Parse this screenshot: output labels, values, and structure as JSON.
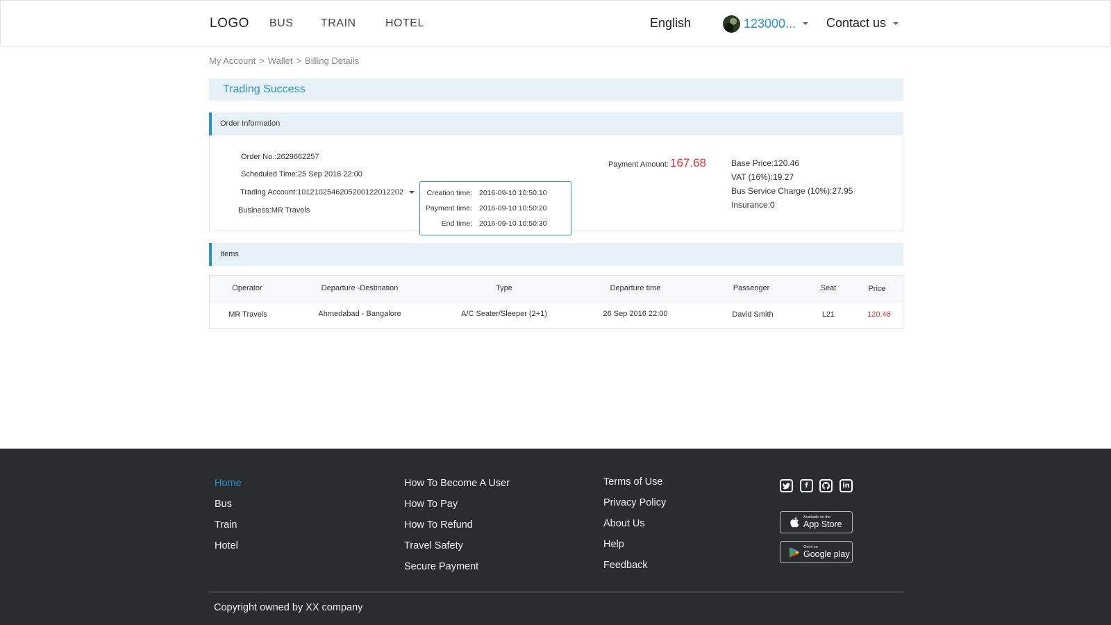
{
  "header": {
    "logo": "LOGO",
    "nav": [
      "BUS",
      "TRAIN",
      "HOTEL"
    ],
    "language": "English",
    "user_name": "123000...",
    "contact": "Contact us"
  },
  "breadcrumb": {
    "items": [
      "My Account",
      "Wallet",
      "Billing Details"
    ],
    "separator": ">"
  },
  "status_title": "Trading Success",
  "order": {
    "section_title": "Order Information",
    "order_no": "Order No.:2629662257",
    "scheduled_time": "Scheduled Time:25  Sep  2016 22:00",
    "trading_account": "Trading Account:1012102546205200122012202",
    "business": "Business:MR Travels",
    "times": [
      {
        "label": "Creation time:",
        "value": "2016-09-10 10:50:10"
      },
      {
        "label": "Payment time:",
        "value": "2016-09-10 10:50:20"
      },
      {
        "label": "End time:",
        "value": "2016-09-10 10:50:30"
      }
    ],
    "payment_label": "Payment  Amount:",
    "payment_amount": "167.68",
    "base_price": "Base Price:120.46",
    "vat": "VAT (16%):19.27",
    "service_charge": "Bus Service Charge (10%):27.95",
    "insurance": "Insurance:0"
  },
  "items": {
    "section_title": "Items",
    "headers": [
      "Operator",
      "Departure -Destination",
      "Type",
      "Departure time",
      "Passenger",
      "Seat",
      "Price"
    ],
    "rows": [
      [
        "MR Travels",
        "Ahmedabad - Bangalore",
        "A/C Seater/Sleeper (2+1)",
        "26  Sep  2016 22:00",
        "David  Smith",
        "L21",
        "120.46"
      ]
    ]
  },
  "footer": {
    "col1": [
      "Home",
      "Bus",
      "Train",
      "Hotel"
    ],
    "col2": [
      "How To Become A User",
      "How To Pay",
      "How To Refund",
      "Travel Safety",
      "Secure Payment"
    ],
    "col3": [
      "Terms of Use",
      "Privacy Policy",
      "About Us",
      "Help",
      "Feedback"
    ],
    "social_icons": [
      "twitter-icon",
      "facebook-icon",
      "github-icon",
      "linkedin-icon"
    ],
    "app_store": {
      "small": "Available on the",
      "big": "App Store"
    },
    "google_play": {
      "small": "Get it on",
      "big": "Google play"
    },
    "copyright": "Copyright owned by XX company"
  },
  "colors": {
    "accent": "#2a93c9",
    "price_red": "#e8323a",
    "banner_bg": "#e6f1f8",
    "footer_bg": "#2b2c2e"
  }
}
